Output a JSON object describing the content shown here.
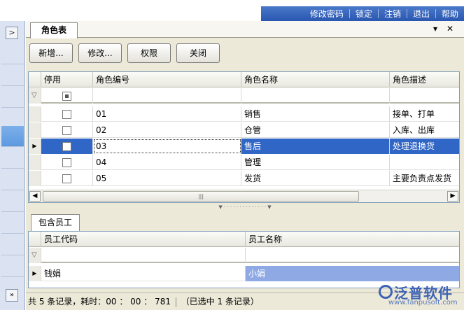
{
  "topnav": [
    "修改密码",
    "锁定",
    "注销",
    "退出",
    "帮助"
  ],
  "tab": {
    "title": "角色表",
    "pin_glyph": "▾",
    "close_glyph": "✕"
  },
  "toolbar": {
    "add": "新增...",
    "edit": "修改...",
    "perm": "权限",
    "close": "关闭"
  },
  "roles": {
    "columns": [
      "停用",
      "角色编号",
      "角色名称",
      "角色描述"
    ],
    "rows": [
      {
        "id": "01",
        "name": "销售",
        "desc": "接单、打单"
      },
      {
        "id": "02",
        "name": "仓管",
        "desc": "入库、出库"
      },
      {
        "id": "03",
        "name": "售后",
        "desc": "处理退换货"
      },
      {
        "id": "04",
        "name": "管理",
        "desc": ""
      },
      {
        "id": "05",
        "name": "发货",
        "desc": "主要负责点发货"
      }
    ],
    "selected_index": 2,
    "scroll_thumb_glyph": "|||"
  },
  "employees": {
    "tab_label": "包含员工",
    "columns": [
      "员工代码",
      "员工名称"
    ],
    "rows": [
      {
        "code": "钱娟",
        "name": "小娟"
      }
    ]
  },
  "status": {
    "text1": "共 5 条记录，耗时：00 ： 00 ： 781",
    "text2": "（已选中 1 条记录）"
  },
  "logo": {
    "name": "泛普软件",
    "url": "www.fanpusoft.com"
  },
  "colors": {
    "accent": "#3066c5",
    "nav": "#2a57b0"
  }
}
